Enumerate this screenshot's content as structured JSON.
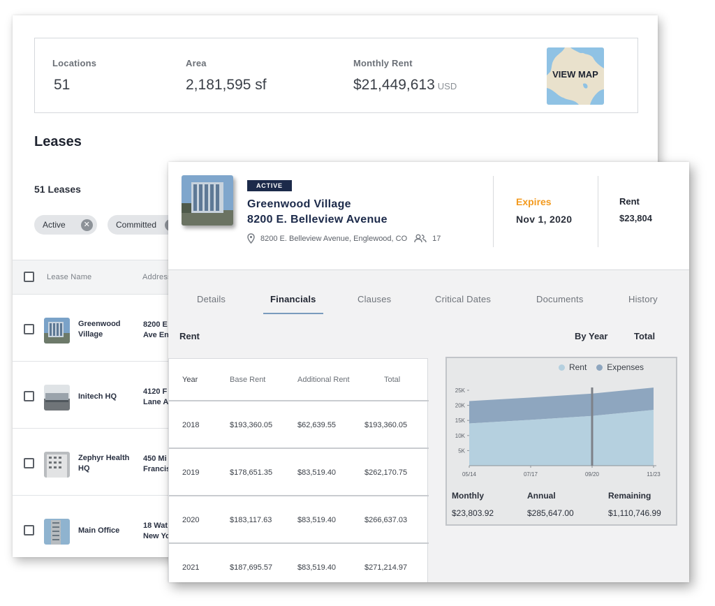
{
  "summary": {
    "locations_label": "Locations",
    "locations_value": "51",
    "area_label": "Area",
    "area_value": "2,181,595 sf",
    "rent_label": "Monthly Rent",
    "rent_value": "$21,449,613",
    "rent_unit": "USD",
    "map_button": "VIEW MAP"
  },
  "leases": {
    "title": "Leases",
    "count": "51 Leases",
    "filters": [
      "Active",
      "Committed"
    ],
    "columns": [
      "Lease Name",
      "Address"
    ],
    "rows": [
      {
        "name": "Greenwood Village",
        "address_line1": "8200 E",
        "address_line2": "Ave En"
      },
      {
        "name": "Initech HQ",
        "address_line1": "4120 F",
        "address_line2": "Lane A"
      },
      {
        "name": "Zephyr Health HQ",
        "address_line1": "450 Mi",
        "address_line2": "Francis"
      },
      {
        "name": "Main Office",
        "address_line1": "18 Wat",
        "address_line2": "New Yo"
      }
    ]
  },
  "detail": {
    "status_badge": "ACTIVE",
    "name_line1": "Greenwood Village",
    "name_line2": "8200 E. Belleview Avenue",
    "address": "8200 E. Belleview Avenue, Englewood, CO",
    "occupants": "17",
    "expires_label": "Expires",
    "expires_value": "Nov 1, 2020",
    "rent_label": "Rent",
    "rent_value": "$23,804",
    "tabs": [
      "Details",
      "Financials",
      "Clauses",
      "Critical Dates",
      "Documents",
      "History"
    ],
    "active_tab": "Financials",
    "section_title": "Rent",
    "toggle_by_year": "By Year",
    "toggle_total": "Total",
    "table": {
      "headers": [
        "Year",
        "Base Rent",
        "Additional Rent",
        "Total"
      ],
      "rows": [
        [
          "2018",
          "$193,360.05",
          "$62,639.55",
          "$193,360.05"
        ],
        [
          "2019",
          "$178,651.35",
          "$83,519.40",
          "$262,170.75"
        ],
        [
          "2020",
          "$183,117.63",
          "$83,519.40",
          "$266,637.03"
        ],
        [
          "2021",
          "$187,695.57",
          "$83,519.40",
          "$271,214.97"
        ]
      ]
    },
    "metrics": {
      "monthly_label": "Monthly",
      "monthly_value": "$23,803.92",
      "annual_label": "Annual",
      "annual_value": "$285,647.00",
      "remaining_label": "Remaining",
      "remaining_value": "$1,110,746.99"
    }
  },
  "colors": {
    "navy": "#1c2a4a",
    "orange": "#f39a1e",
    "rent_area": "#b5d0df",
    "expenses_area": "#8ea6bf",
    "marker": "#7d8188"
  },
  "chart_data": {
    "type": "area",
    "stacked": true,
    "legend": [
      "Rent",
      "Expenses"
    ],
    "legend_placement": "top-right",
    "x_ticks": [
      "05/14",
      "07/17",
      "09/20",
      "11/23"
    ],
    "y_ticks": [
      "5K",
      "10K",
      "15K",
      "20K",
      "25K"
    ],
    "ylim": [
      0,
      25000
    ],
    "x": [
      "05/14",
      "07/17",
      "09/20",
      "11/23"
    ],
    "series": [
      {
        "name": "Rent",
        "values": [
          14000,
          15200,
          16500,
          18500
        ]
      },
      {
        "name": "Expenses",
        "values": [
          7400,
          7400,
          7400,
          7400
        ]
      }
    ],
    "marker_x": "09/20"
  }
}
